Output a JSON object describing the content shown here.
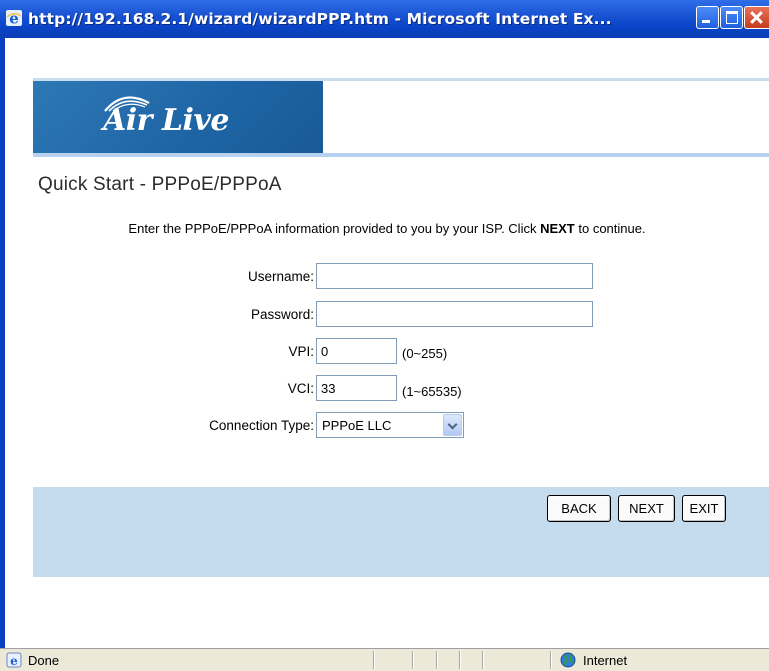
{
  "window": {
    "title": "http://192.168.2.1/wizard/wizardPPP.htm - Microsoft Internet Ex..."
  },
  "brand": {
    "logo_text": "Air Live"
  },
  "page": {
    "title": "Quick Start - PPPoE/PPPoA",
    "instruction_pre": "Enter the PPPoE/PPPoA information provided to you by your ISP. Click ",
    "instruction_bold": "NEXT",
    "instruction_post": " to continue."
  },
  "form": {
    "username": {
      "label": "Username:",
      "value": ""
    },
    "password": {
      "label": "Password:",
      "value": ""
    },
    "vpi": {
      "label": "VPI:",
      "value": "0",
      "hint": "(0~255)"
    },
    "vci": {
      "label": "VCI:",
      "value": "33",
      "hint": "(1~65535)"
    },
    "connection_type": {
      "label": "Connection Type:",
      "selected": "PPPoE LLC"
    }
  },
  "buttons": {
    "back": "BACK",
    "next": "NEXT",
    "exit": "EXIT"
  },
  "statusbar": {
    "status": "Done",
    "zone": "Internet"
  },
  "colors": {
    "titlebar": "#0a44c8",
    "logo_bg": "#1e64a4",
    "button_bar": "#c5dcef"
  }
}
